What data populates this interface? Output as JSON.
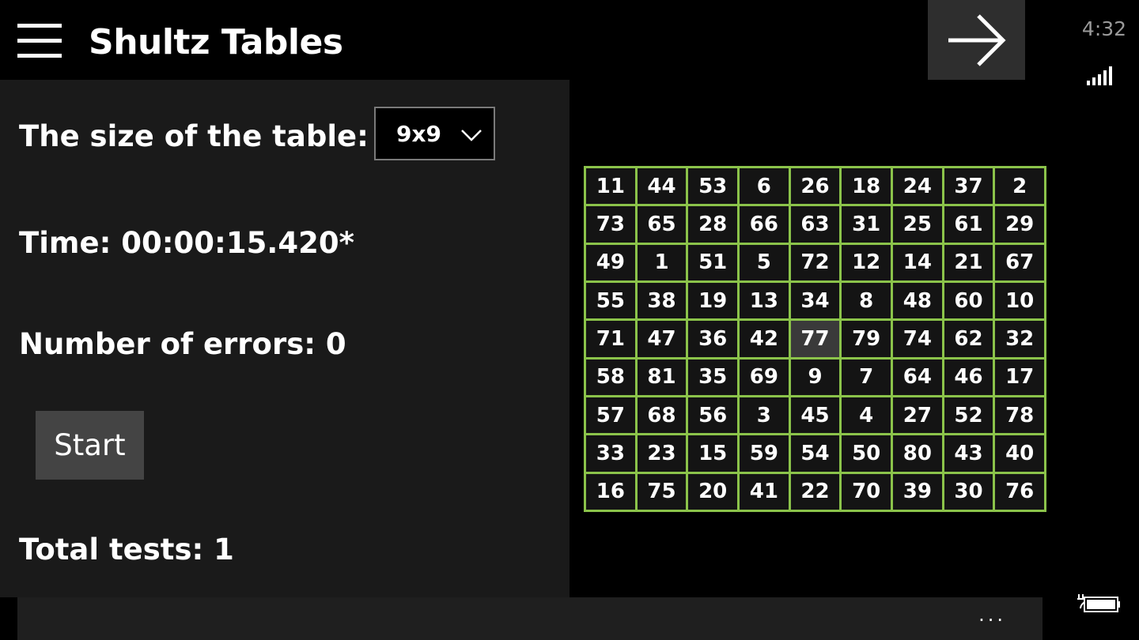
{
  "header": {
    "title": "Shultz Tables"
  },
  "status": {
    "time": "4:32"
  },
  "settings": {
    "size_label": "The size of the table:",
    "size_value": "9x9"
  },
  "stats": {
    "time_text": "Time: 00:00:15.420*",
    "errors_text": "Number of errors: 0",
    "total_text": "Total tests: 1"
  },
  "actions": {
    "start_label": "Start",
    "more_label": "..."
  },
  "grid": {
    "rows": [
      [
        "11",
        "44",
        "53",
        "6",
        "26",
        "18",
        "24",
        "37",
        "2"
      ],
      [
        "73",
        "65",
        "28",
        "66",
        "63",
        "31",
        "25",
        "61",
        "29"
      ],
      [
        "49",
        "1",
        "51",
        "5",
        "72",
        "12",
        "14",
        "21",
        "67"
      ],
      [
        "55",
        "38",
        "19",
        "13",
        "34",
        "8",
        "48",
        "60",
        "10"
      ],
      [
        "71",
        "47",
        "36",
        "42",
        "77",
        "79",
        "74",
        "62",
        "32"
      ],
      [
        "58",
        "81",
        "35",
        "69",
        "9",
        "7",
        "64",
        "46",
        "17"
      ],
      [
        "57",
        "68",
        "56",
        "3",
        "45",
        "4",
        "27",
        "52",
        "78"
      ],
      [
        "33",
        "23",
        "15",
        "59",
        "54",
        "50",
        "80",
        "43",
        "40"
      ],
      [
        "16",
        "75",
        "20",
        "41",
        "22",
        "70",
        "39",
        "30",
        "76"
      ]
    ],
    "highlighted_value": "77"
  },
  "icons": {
    "menu": "hamburger-icon",
    "next": "arrow-right-icon",
    "dropdown": "chevron-down-icon",
    "signal": "signal-icon",
    "battery": "battery-charging-icon"
  },
  "colors": {
    "grid_border": "#8bc34a",
    "panel": "#1a1a1a",
    "highlight_cell": "#3a3a3a"
  }
}
